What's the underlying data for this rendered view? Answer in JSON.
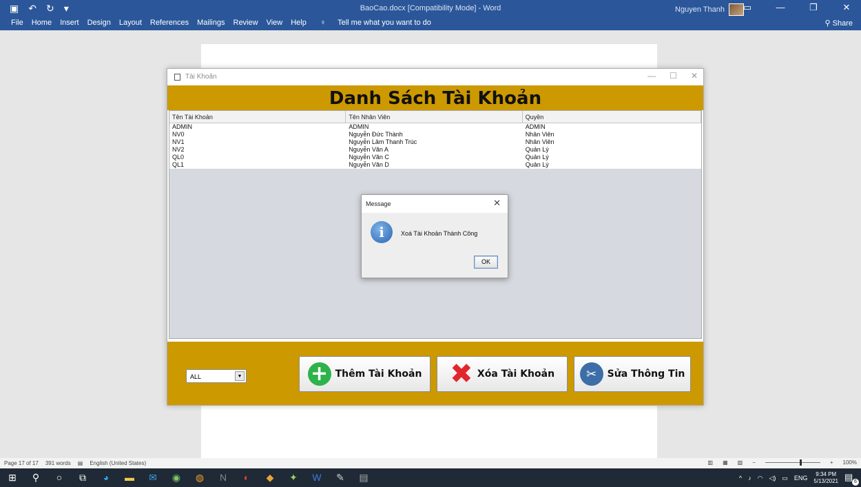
{
  "word": {
    "document_title": "BaoCao.docx [Compatibility Mode] - Word",
    "user_name": "Nguyen Thanh",
    "menu": [
      "File",
      "Home",
      "Insert",
      "Design",
      "Layout",
      "References",
      "Mailings",
      "Review",
      "View",
      "Help"
    ],
    "tell_me": "Tell me what you want to do",
    "share": "Share",
    "status": {
      "page": "Page 17 of 17",
      "words": "391 words",
      "language": "English (United States)",
      "zoom": "100%"
    }
  },
  "app_window": {
    "title": "Tài Khoản",
    "heading": "Danh Sách Tài Khoản",
    "columns": [
      "Tên Tài Khoản",
      "Tên Nhân Viên",
      "Quyền"
    ],
    "rows": [
      [
        "ADMIN",
        "ADMIN",
        "ADMIN"
      ],
      [
        "NV0",
        "Nguyễn Đức Thành",
        "Nhân Viên"
      ],
      [
        "NV1",
        "Nguyễn Lâm Thanh Trúc",
        "Nhân Viên"
      ],
      [
        "NV2",
        "Nguyễn Văn A",
        "Quản Lý"
      ],
      [
        "QL0",
        "Nguyễn Văn C",
        "Quản Lý"
      ],
      [
        "QL1",
        "Nguyễn Văn D",
        "Quản Lý"
      ]
    ],
    "filter_value": "ALL",
    "buttons": {
      "add": "Thêm Tài Khoản",
      "delete": "Xóa Tài Khoản",
      "edit": "Sửa Thông Tin"
    }
  },
  "dialog": {
    "title": "Message",
    "message": "Xoá Tài Khoản Thành Công",
    "ok": "OK"
  },
  "taskbar": {
    "language": "ENG",
    "time": "9:34 PM",
    "date": "5/13/2021",
    "notifications": "6"
  }
}
